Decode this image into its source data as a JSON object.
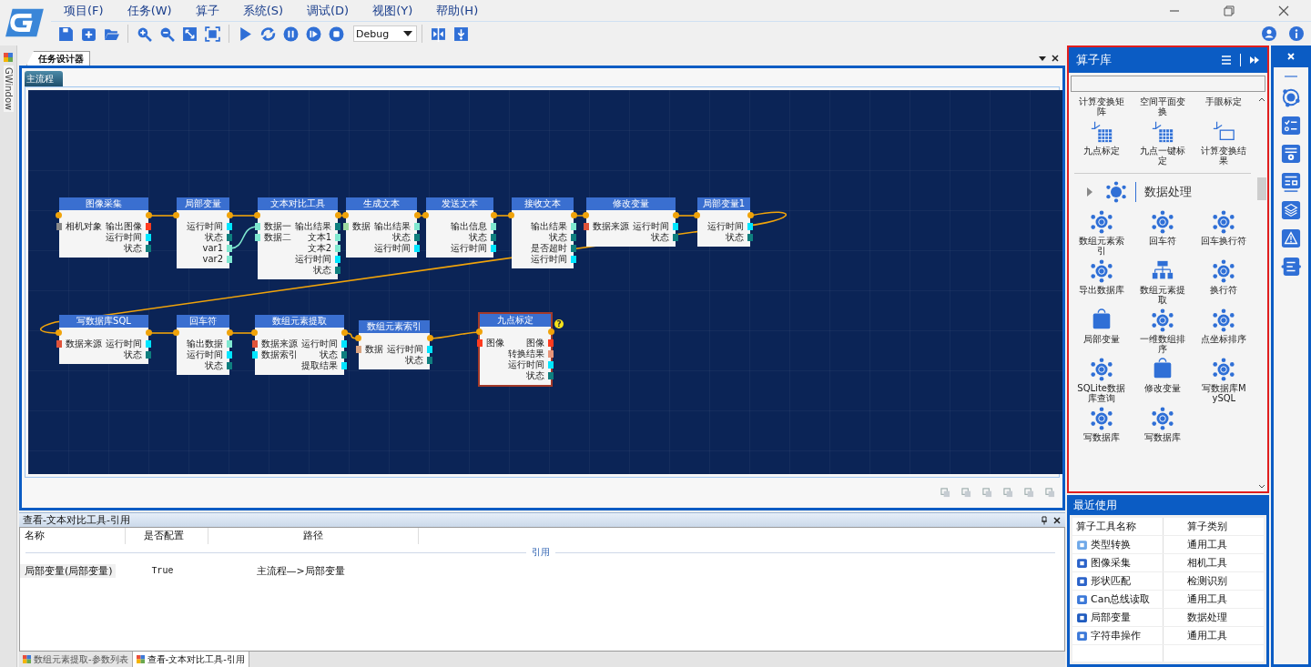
{
  "menu": [
    "项目(F)",
    "任务(W)",
    "算子",
    "系统(S)",
    "调试(D)",
    "视图(Y)",
    "帮助(H)"
  ],
  "toolbar": {
    "mode": "Debug"
  },
  "side_tab": {
    "label": "GWindow"
  },
  "doc_tabs": [
    {
      "label": "任务设计器",
      "selected": true
    }
  ],
  "flow_tabs": [
    {
      "label": "主流程",
      "selected": true
    }
  ],
  "nodes": [
    {
      "title": "图像采集",
      "selected": false,
      "rows": [
        {
          "left": {
            "label": "相机对象",
            "color": "#8a8a8a"
          },
          "right": {
            "label": "输出图像",
            "color": "#ff3b1f"
          }
        },
        {
          "right": {
            "label": "运行时间",
            "color": "#00e5ff"
          }
        },
        {
          "right": {
            "label": "状态",
            "color": "#0f7f7f"
          }
        }
      ]
    },
    {
      "title": "局部变量",
      "selected": false,
      "rows": [
        {
          "right": {
            "label": "运行时间",
            "color": "#00e5ff"
          }
        },
        {
          "right": {
            "label": "状态",
            "color": "#0f7f7f"
          }
        },
        {
          "right": {
            "label": "var1",
            "color": "#7fe8d0"
          }
        },
        {
          "right": {
            "label": "var2",
            "color": "#7fe8d0"
          }
        }
      ]
    },
    {
      "title": "文本对比工具",
      "selected": false,
      "rows": [
        {
          "left": {
            "label": "数据一",
            "color": "#7fe8d0"
          },
          "right": {
            "label": "输出结果",
            "color": "#0f7f7f"
          }
        },
        {
          "left": {
            "label": "数据二",
            "color": "#7fe8d0"
          },
          "right": {
            "label": "文本1",
            "color": "#7fe8d0"
          }
        },
        {
          "right": {
            "label": "文本2",
            "color": "#7fe8d0"
          }
        },
        {
          "right": {
            "label": "运行时间",
            "color": "#00e5ff"
          }
        },
        {
          "right": {
            "label": "状态",
            "color": "#0f7f7f"
          }
        }
      ]
    },
    {
      "title": "生成文本",
      "selected": false,
      "rows": [
        {
          "left": {
            "label": "数据",
            "color": "#9ed9a0"
          },
          "right": {
            "label": "输出结果",
            "color": "#7fe8d0"
          }
        },
        {
          "right": {
            "label": "状态",
            "color": "#0f7f7f"
          }
        },
        {
          "right": {
            "label": "运行时间",
            "color": "#00e5ff"
          }
        }
      ]
    },
    {
      "title": "发送文本",
      "selected": false,
      "rows": [
        {
          "right": {
            "label": "输出信息",
            "color": "#7fe8d0"
          }
        },
        {
          "right": {
            "label": "状态",
            "color": "#0f7f7f"
          }
        },
        {
          "right": {
            "label": "运行时间",
            "color": "#00e5ff"
          }
        }
      ]
    },
    {
      "title": "接收文本",
      "selected": false,
      "rows": [
        {
          "right": {
            "label": "输出结果",
            "color": "#7fe8d0"
          }
        },
        {
          "right": {
            "label": "状态",
            "color": "#0f7f7f"
          }
        },
        {
          "right": {
            "label": "是否超时",
            "color": "#0f7f7f"
          }
        },
        {
          "right": {
            "label": "运行时间",
            "color": "#00e5ff"
          }
        }
      ]
    },
    {
      "title": "修改变量",
      "selected": false,
      "rows": [
        {
          "left": {
            "label": "数据来源",
            "color": "#e0533a"
          },
          "right": {
            "label": "运行时间",
            "color": "#00e5ff"
          }
        },
        {
          "right": {
            "label": "状态",
            "color": "#0f7f7f"
          }
        }
      ]
    },
    {
      "title": "局部变量1",
      "selected": false,
      "rows": [
        {
          "right": {
            "label": "运行时间",
            "color": "#00e5ff"
          }
        },
        {
          "right": {
            "label": "状态",
            "color": "#0f7f7f"
          }
        }
      ]
    },
    {
      "title": "写数据库SQL",
      "selected": false,
      "rows": [
        {
          "left": {
            "label": "数据来源",
            "color": "#e0533a"
          },
          "right": {
            "label": "运行时间",
            "color": "#00e5ff"
          }
        },
        {
          "right": {
            "label": "状态",
            "color": "#0f7f7f"
          }
        }
      ]
    },
    {
      "title": "回车符",
      "selected": false,
      "rows": [
        {
          "right": {
            "label": "输出数据",
            "color": "#7fe8d0"
          }
        },
        {
          "right": {
            "label": "运行时间",
            "color": "#00e5ff"
          }
        },
        {
          "right": {
            "label": "状态",
            "color": "#0f7f7f"
          }
        }
      ]
    },
    {
      "title": "数组元素提取",
      "selected": false,
      "rows": [
        {
          "left": {
            "label": "数据来源",
            "color": "#e0533a"
          },
          "right": {
            "label": "运行时间",
            "color": "#00e5ff"
          }
        },
        {
          "left": {
            "label": "数据索引",
            "color": "#00e5ff"
          },
          "right": {
            "label": "状态",
            "color": "#0f7f7f"
          }
        },
        {
          "right": {
            "label": "提取结果",
            "color": "#00e5ff"
          }
        }
      ]
    },
    {
      "title": "数组元素索引",
      "selected": false,
      "rows": [
        {
          "left": {
            "label": "数据",
            "color": "#d9a27f"
          },
          "right": {
            "label": "运行时间",
            "color": "#00e5ff"
          }
        },
        {
          "right": {
            "label": "状态",
            "color": "#0f7f7f"
          }
        }
      ]
    },
    {
      "title": "九点标定",
      "selected": true,
      "badge": "?",
      "rows": [
        {
          "left": {
            "label": "图像",
            "color": "#ff3b1f"
          },
          "right": {
            "label": "图像",
            "color": "#ff3b1f"
          }
        },
        {
          "right": {
            "label": "转换结果",
            "color": "#e8957a"
          }
        },
        {
          "right": {
            "label": "运行时间",
            "color": "#00e5ff"
          }
        },
        {
          "right": {
            "label": "状态",
            "color": "#0f7f7f"
          }
        }
      ]
    }
  ],
  "reference_panel": {
    "title": "查看-文本对比工具-引用",
    "columns": [
      "名称",
      "是否配置",
      "路径"
    ],
    "group": "引用",
    "rows": [
      {
        "name": "局部变量(局部变量)",
        "configured": "True",
        "path": "主流程—>局部变量"
      }
    ]
  },
  "bottom_tabs": [
    {
      "label": "数组元素提取-参数列表",
      "selected": false
    },
    {
      "label": "查看-文本对比工具-引用",
      "selected": true
    }
  ],
  "operator_library": {
    "title": "算子库",
    "items": [
      "计算变换矩阵",
      "空间平面变换",
      "手眼标定",
      "九点标定",
      "九点一键标定",
      "计算变换结果"
    ],
    "category": {
      "title": "数据处理",
      "items": [
        "数组元素索引",
        "回车符",
        "回车换行符",
        "导出数据库",
        "数组元素提取",
        "换行符",
        "局部变量",
        "一维数组排序",
        "点坐标排序",
        "SQLite数据库查询",
        "修改变量",
        "写数据库MySQL",
        "写数据库",
        "写数据库"
      ]
    }
  },
  "recent": {
    "title": "最近使用",
    "columns": [
      "算子工具名称",
      "算子类别"
    ],
    "rows": [
      {
        "name": "类型转换",
        "category": "通用工具"
      },
      {
        "name": "图像采集",
        "category": "相机工具"
      },
      {
        "name": "形状匹配",
        "category": "检测识别"
      },
      {
        "name": "Can总线读取",
        "category": "通用工具"
      },
      {
        "name": "局部变量",
        "category": "数据处理"
      },
      {
        "name": "字符串操作",
        "category": "通用工具"
      }
    ]
  }
}
